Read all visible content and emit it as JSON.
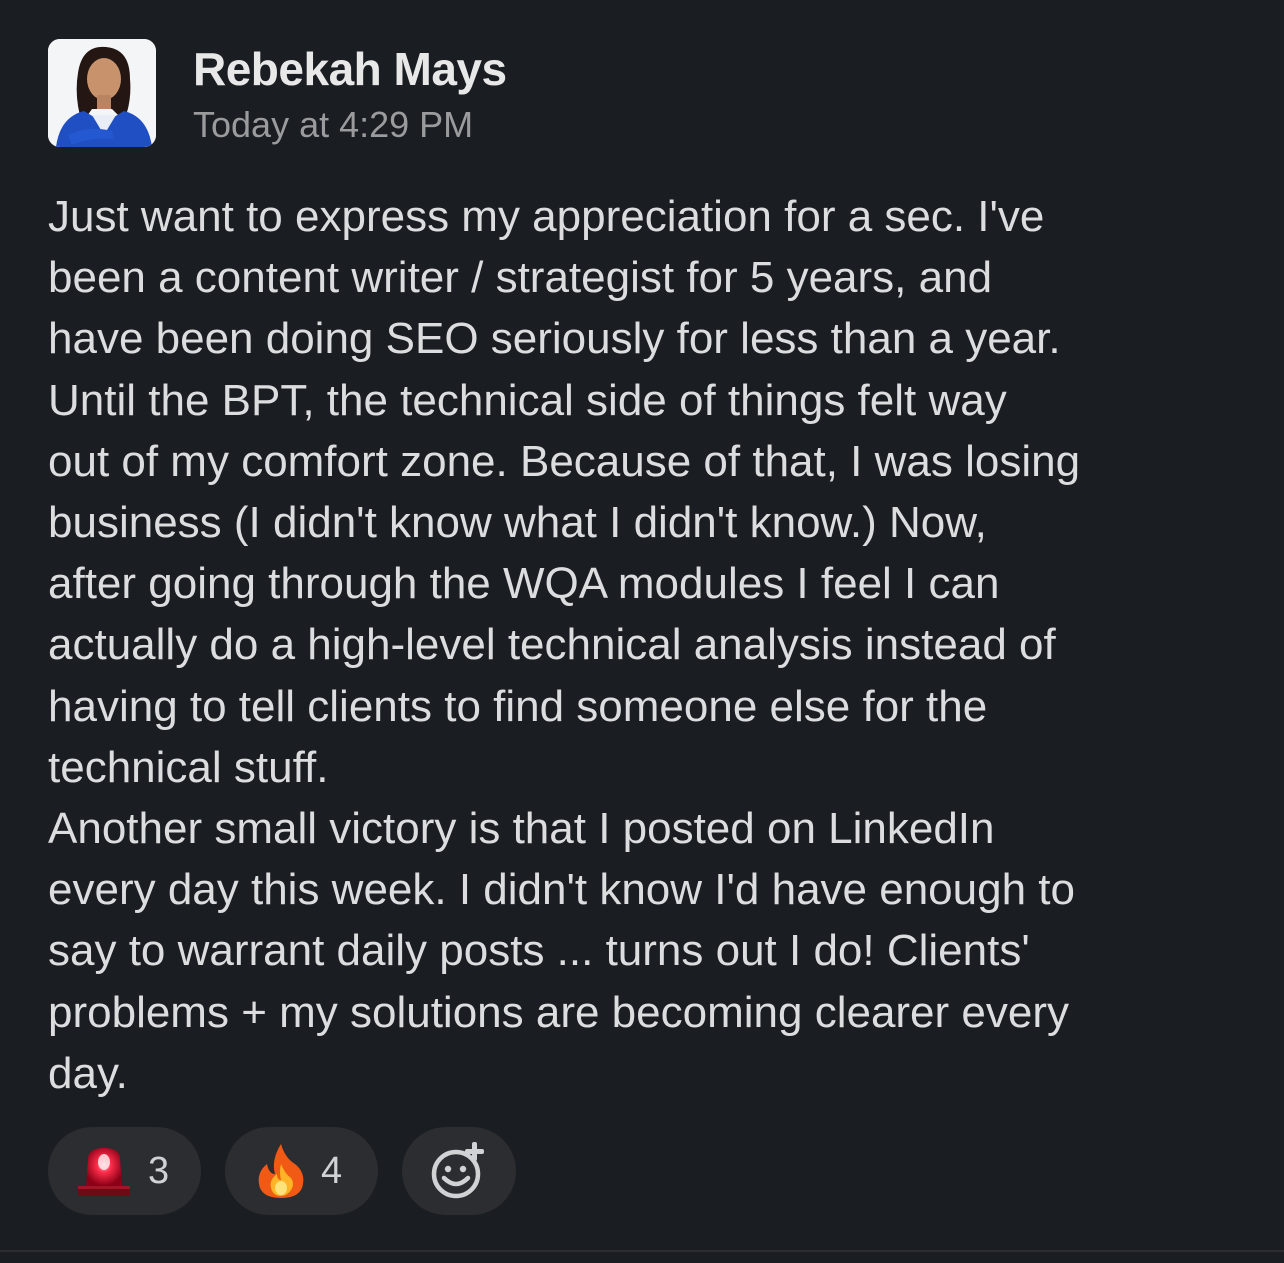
{
  "message": {
    "author": "Rebekah Mays",
    "timestamp": "Today at 4:29 PM",
    "body_lines": [
      "Just want to express my appreciation for a sec. I've",
      "been a content writer / strategist for 5 years, and",
      "have been doing SEO seriously for less than a year.",
      "Until the BPT, the technical side of things felt way",
      "out of my comfort zone. Because of that, I was losing",
      "business (I didn't know what I didn't know.) Now,",
      "after going through the WQA modules I feel I can",
      "actually do a high-level technical analysis instead of",
      "having to tell clients to find someone else for the",
      "technical stuff.",
      "Another small victory is that I posted on LinkedIn",
      "every day this week. I didn't know I'd have enough to",
      "say to warrant daily posts ... turns out I do! Clients'",
      "problems + my solutions are becoming clearer every",
      "day."
    ]
  },
  "reactions": [
    {
      "icon": "siren-icon",
      "count": "3"
    },
    {
      "icon": "fire-icon",
      "count": "4"
    },
    {
      "icon": "add-reaction-icon"
    }
  ],
  "colors": {
    "background": "#1a1d21",
    "reaction_pill": "#2b2d31",
    "text": "#dcdddf",
    "muted": "#9a9b9d"
  }
}
